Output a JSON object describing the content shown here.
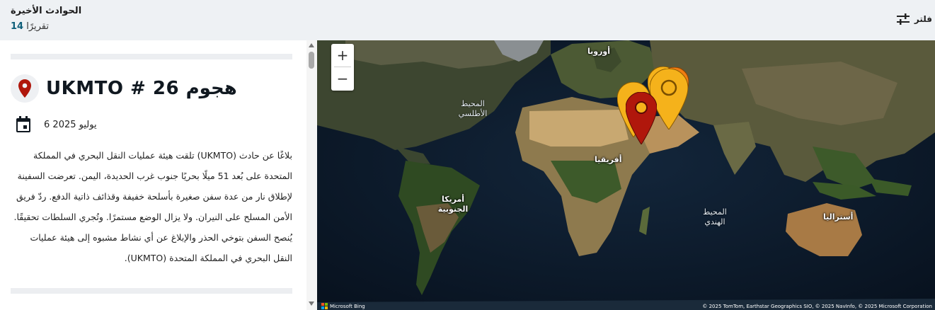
{
  "header": {
    "title": "الحوادث الأخيرة",
    "count_number": "14",
    "count_label": "تقريرًا",
    "filter_label": "فلتر"
  },
  "incident": {
    "title": "UKMTO # 26 هجوم",
    "date": "يوليو 2025 6",
    "description": "بلاغًا عن حادث (UKMTO) تلقت هيئة عمليات النقل البحري في المملكة المتحدة على بُعد 51 ميلًا بحريًا جنوب غرب الحديدة، اليمن. تعرضت السفينة لإطلاق نار من عدة سفن صغيرة بأسلحة خفيفة وقذائف ذاتية الدفع. ردّ فريق الأمن المسلح على النيران. ولا يزال الوضع مستمرًا. وتُجري السلطات تحقيقًا. يُنصح السفن بتوخي الحذر والإبلاغ عن أي نشاط مشبوه إلى هيئة عمليات النقل البحري في المملكة المتحدة (UKMTO)."
  },
  "map": {
    "zoom_in": "+",
    "zoom_out": "−",
    "labels": {
      "europe": "أوروبا",
      "africa": "أفريقيا",
      "south_america": "أمريكا الجنوبية",
      "australia": "أستراليا",
      "atlantic": "المحيط الأطلسي",
      "indian": "المحيط الهندي"
    },
    "attribution_logo": "Microsoft Bing",
    "attribution_text": "© 2025 TomTom, Earthstar Geographics SIO, © 2025 NavInfo, © 2025 Microsoft Corporation"
  },
  "icons": [
    "filter-sliders-icon",
    "location-pin-icon",
    "calendar-icon",
    "zoom-in-icon",
    "zoom-out-icon",
    "map-pin-icon"
  ],
  "colors": {
    "pin_red": "#b0170c",
    "pin_yellow": "#f5b21b",
    "pin_orange": "#f07d12",
    "accent": "#0f5f7a"
  }
}
